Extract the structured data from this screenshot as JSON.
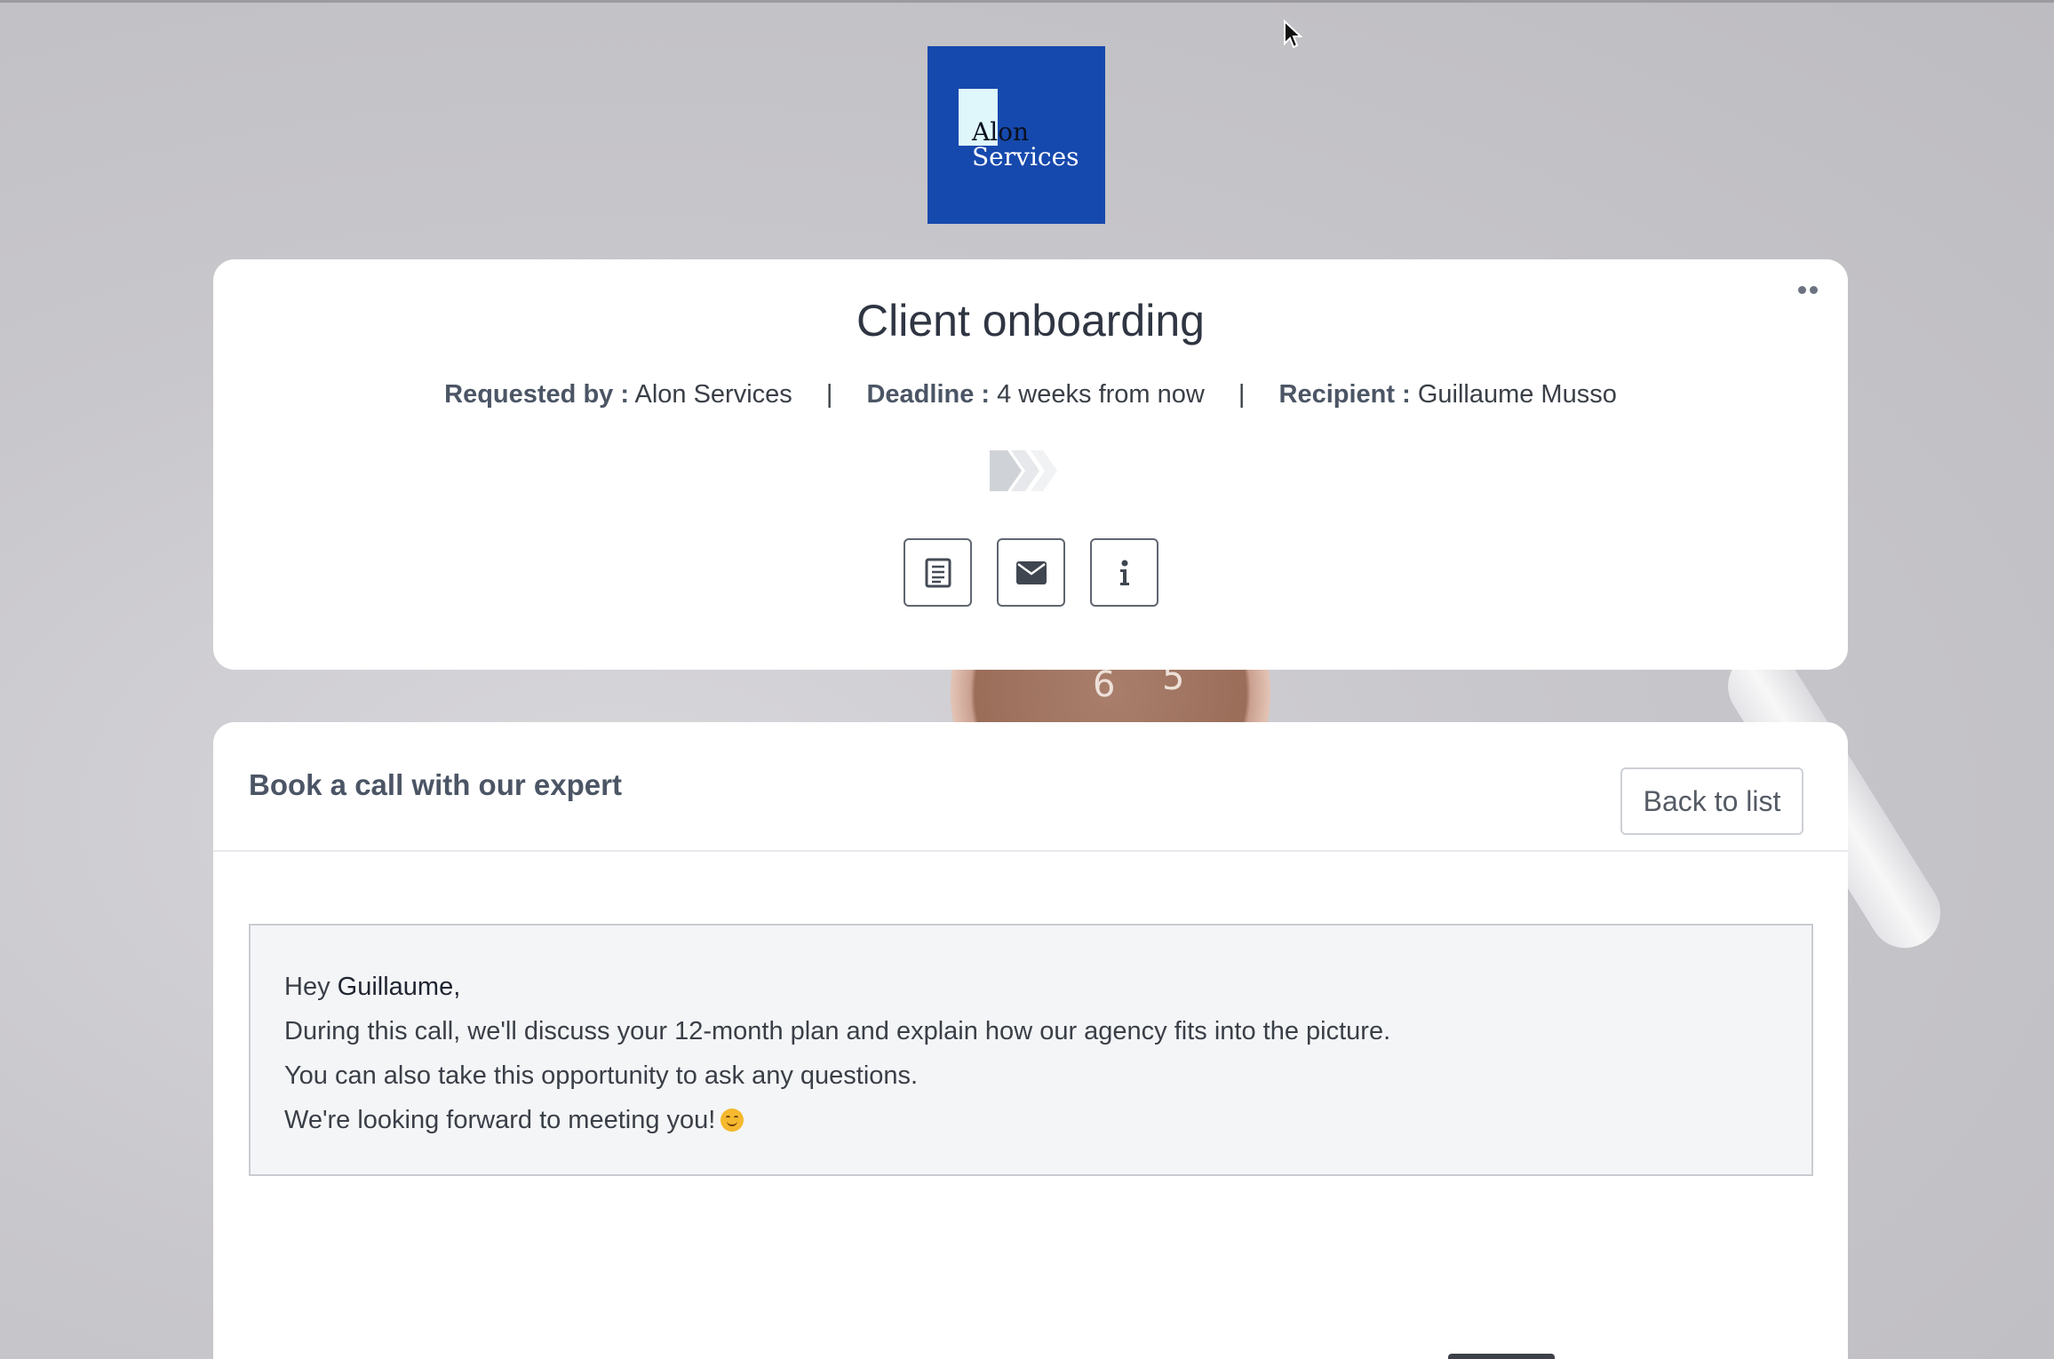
{
  "logo": {
    "line1": "Alon",
    "line2": "Services",
    "bg_color": "#1649ad"
  },
  "header": {
    "title": "Client onboarding",
    "requested_by_label": "Requested by :",
    "requested_by_value": "Alon Services",
    "deadline_label": "Deadline :",
    "deadline_value": "4 weeks from now",
    "recipient_label": "Recipient :",
    "recipient_value": "Guillaume Musso",
    "separator": "|",
    "more_icon": "more-dots-icon",
    "action_icons": [
      "document-icon",
      "envelope-icon",
      "info-icon"
    ]
  },
  "section": {
    "title": "Book a call with our expert",
    "back_button": "Back to list",
    "message": {
      "greeting": "Hey ",
      "name": "Guillaume,",
      "line2": "During this call, we'll discuss your 12-month plan and explain how our agency fits into the picture.",
      "line3": "You can also take this opportunity to ask any questions.",
      "line4": "We're looking forward to meeting you!",
      "emoji": "smiling-face-icon"
    }
  },
  "background": {
    "clock_numbers": [
      "6",
      "5"
    ]
  }
}
